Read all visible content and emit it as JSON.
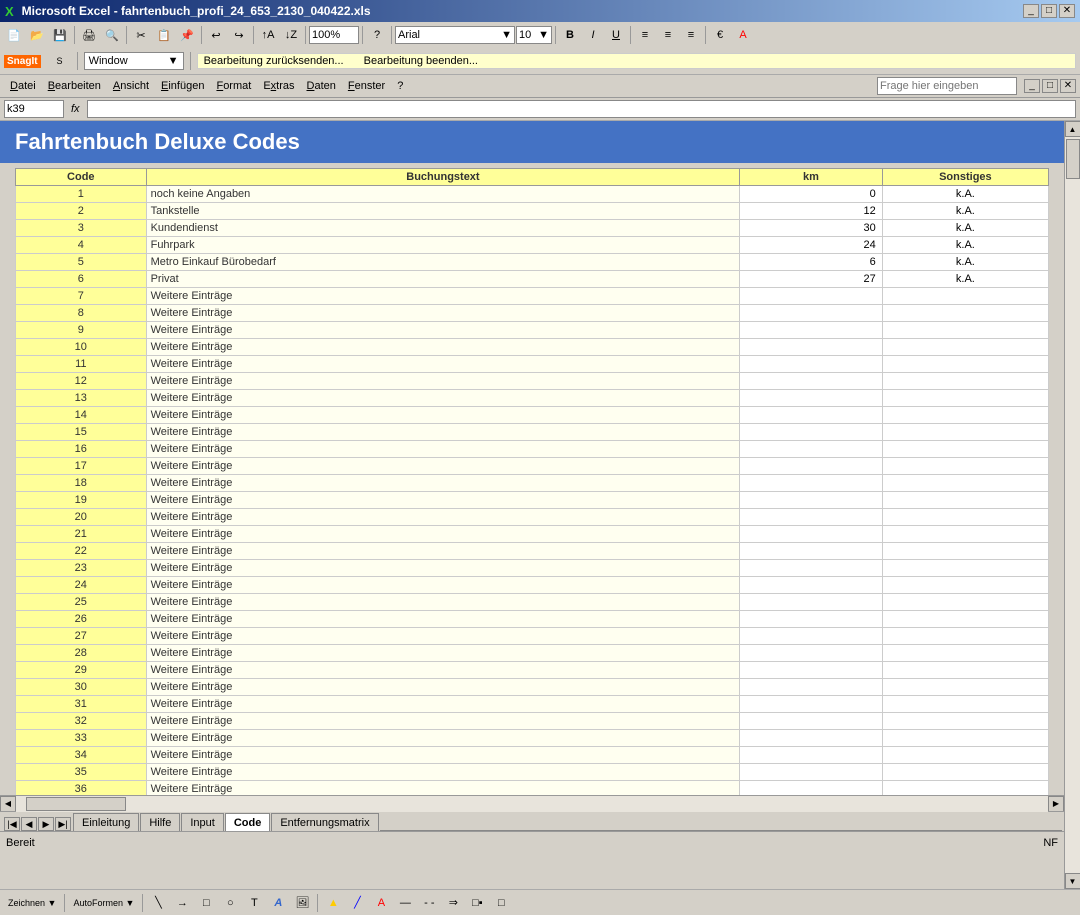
{
  "titleBar": {
    "title": "Microsoft Excel - fahrtenbuch_profi_24_653_2130_040422.xls",
    "icon": "X",
    "controls": [
      "_",
      "□",
      "✕"
    ]
  },
  "toolbar1": {
    "zoom": "100%",
    "zoomDropdown": "▼"
  },
  "toolbar2": {
    "font": "Arial",
    "fontSize": "10"
  },
  "snagitBar": {
    "snagitLabel": "SnagIt",
    "windowLabel": "Window",
    "editingText1": "Bearbeitung zurücksenden...",
    "editingText2": "Bearbeitung beenden..."
  },
  "menuBar": {
    "items": [
      "Datei",
      "Bearbeiten",
      "Ansicht",
      "Einfügen",
      "Format",
      "Extras",
      "Daten",
      "Fenster",
      "?"
    ],
    "helpPlaceholder": "Frage hier eingeben"
  },
  "formulaBar": {
    "cellRef": "k39",
    "fx": "fx"
  },
  "sheetHeader": {
    "title": "Fahrtenbuch Deluxe Codes"
  },
  "tableHeaders": {
    "code": "Code",
    "buchungstext": "Buchungstext",
    "km": "km",
    "sonstiges": "Sonstiges"
  },
  "tableRows": [
    {
      "code": "1",
      "buchungstext": "noch keine Angaben",
      "km": "0",
      "sonstiges": "k.A."
    },
    {
      "code": "2",
      "buchungstext": "Tankstelle",
      "km": "12",
      "sonstiges": "k.A."
    },
    {
      "code": "3",
      "buchungstext": "Kundendienst",
      "km": "30",
      "sonstiges": "k.A."
    },
    {
      "code": "4",
      "buchungstext": "Fuhrpark",
      "km": "24",
      "sonstiges": "k.A."
    },
    {
      "code": "5",
      "buchungstext": "Metro Einkauf Bürobedarf",
      "km": "6",
      "sonstiges": "k.A."
    },
    {
      "code": "6",
      "buchungstext": "Privat",
      "km": "27",
      "sonstiges": "k.A."
    },
    {
      "code": "7",
      "buchungstext": "Weitere Einträge",
      "km": "",
      "sonstiges": ""
    },
    {
      "code": "8",
      "buchungstext": "Weitere Einträge",
      "km": "",
      "sonstiges": ""
    },
    {
      "code": "9",
      "buchungstext": "Weitere Einträge",
      "km": "",
      "sonstiges": ""
    },
    {
      "code": "10",
      "buchungstext": "Weitere Einträge",
      "km": "",
      "sonstiges": ""
    },
    {
      "code": "11",
      "buchungstext": "Weitere Einträge",
      "km": "",
      "sonstiges": ""
    },
    {
      "code": "12",
      "buchungstext": "Weitere Einträge",
      "km": "",
      "sonstiges": ""
    },
    {
      "code": "13",
      "buchungstext": "Weitere Einträge",
      "km": "",
      "sonstiges": ""
    },
    {
      "code": "14",
      "buchungstext": "Weitere Einträge",
      "km": "",
      "sonstiges": ""
    },
    {
      "code": "15",
      "buchungstext": "Weitere Einträge",
      "km": "",
      "sonstiges": ""
    },
    {
      "code": "16",
      "buchungstext": "Weitere Einträge",
      "km": "",
      "sonstiges": ""
    },
    {
      "code": "17",
      "buchungstext": "Weitere Einträge",
      "km": "",
      "sonstiges": ""
    },
    {
      "code": "18",
      "buchungstext": "Weitere Einträge",
      "km": "",
      "sonstiges": ""
    },
    {
      "code": "19",
      "buchungstext": "Weitere Einträge",
      "km": "",
      "sonstiges": ""
    },
    {
      "code": "20",
      "buchungstext": "Weitere Einträge",
      "km": "",
      "sonstiges": ""
    },
    {
      "code": "21",
      "buchungstext": "Weitere Einträge",
      "km": "",
      "sonstiges": ""
    },
    {
      "code": "22",
      "buchungstext": "Weitere Einträge",
      "km": "",
      "sonstiges": ""
    },
    {
      "code": "23",
      "buchungstext": "Weitere Einträge",
      "km": "",
      "sonstiges": ""
    },
    {
      "code": "24",
      "buchungstext": "Weitere Einträge",
      "km": "",
      "sonstiges": ""
    },
    {
      "code": "25",
      "buchungstext": "Weitere Einträge",
      "km": "",
      "sonstiges": ""
    },
    {
      "code": "26",
      "buchungstext": "Weitere Einträge",
      "km": "",
      "sonstiges": ""
    },
    {
      "code": "27",
      "buchungstext": "Weitere Einträge",
      "km": "",
      "sonstiges": ""
    },
    {
      "code": "28",
      "buchungstext": "Weitere Einträge",
      "km": "",
      "sonstiges": ""
    },
    {
      "code": "29",
      "buchungstext": "Weitere Einträge",
      "km": "",
      "sonstiges": ""
    },
    {
      "code": "30",
      "buchungstext": "Weitere Einträge",
      "km": "",
      "sonstiges": ""
    },
    {
      "code": "31",
      "buchungstext": "Weitere Einträge",
      "km": "",
      "sonstiges": ""
    },
    {
      "code": "32",
      "buchungstext": "Weitere Einträge",
      "km": "",
      "sonstiges": ""
    },
    {
      "code": "33",
      "buchungstext": "Weitere Einträge",
      "km": "",
      "sonstiges": ""
    },
    {
      "code": "34",
      "buchungstext": "Weitere Einträge",
      "km": "",
      "sonstiges": ""
    },
    {
      "code": "35",
      "buchungstext": "Weitere Einträge",
      "km": "",
      "sonstiges": ""
    },
    {
      "code": "36",
      "buchungstext": "Weitere Einträge",
      "km": "",
      "sonstiges": ""
    }
  ],
  "sheetTabs": [
    "Einleitung",
    "Hilfe",
    "Input",
    "Code",
    "Entfernungsmatrix"
  ],
  "activeTab": "Code",
  "statusBar": {
    "left": "Bereit",
    "right": "NF"
  }
}
